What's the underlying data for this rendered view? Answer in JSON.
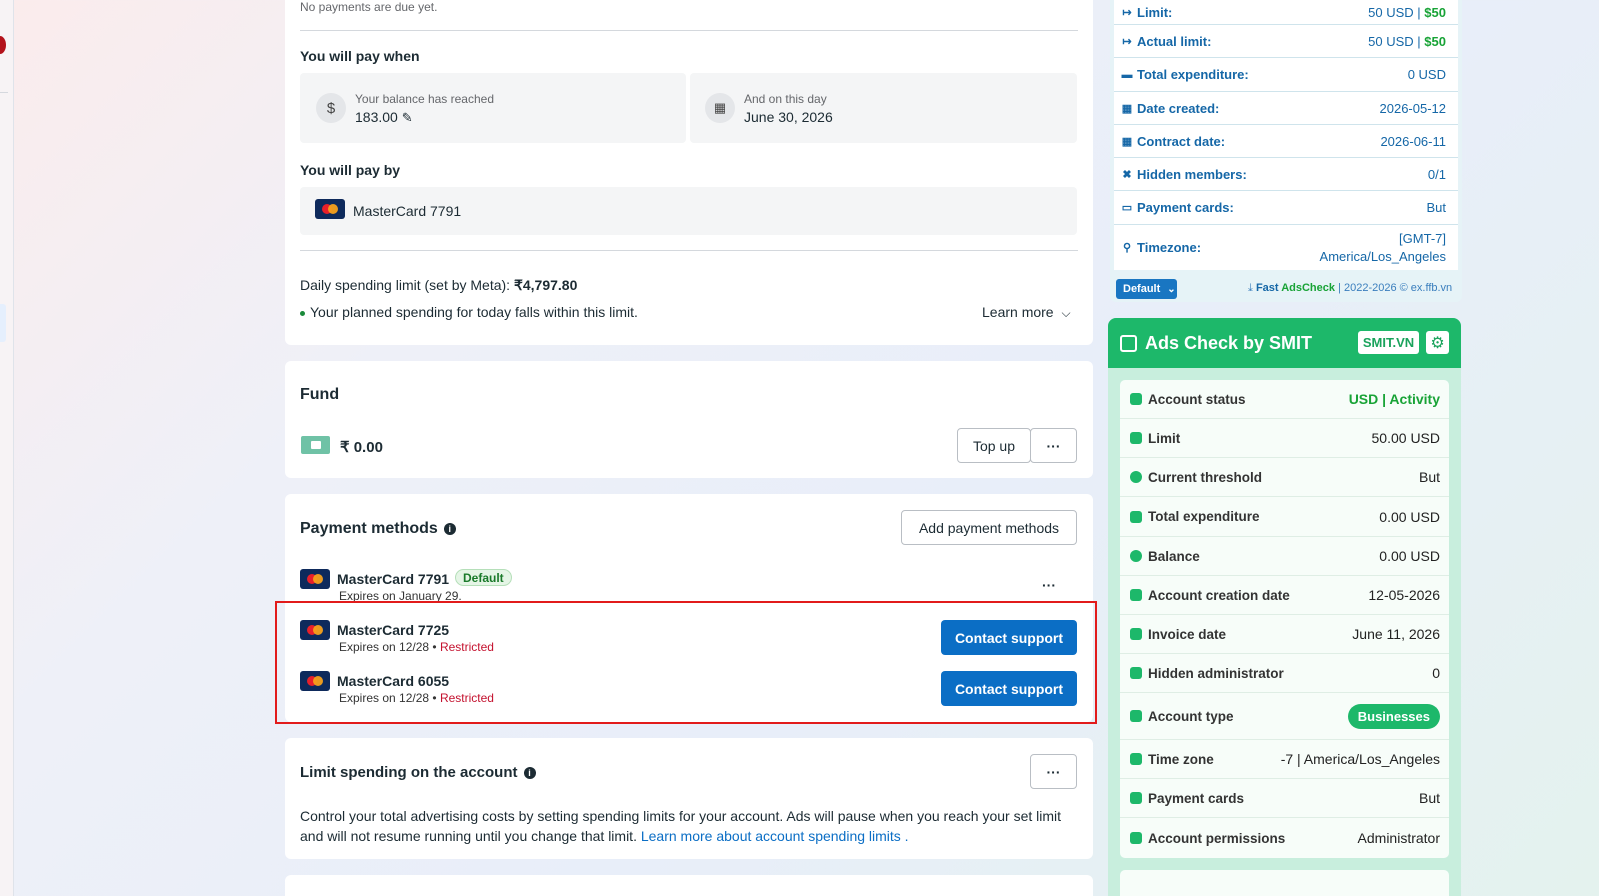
{
  "billing": {
    "no_payments": "No payments are due yet.",
    "pay_when_heading": "You will pay when",
    "balance_label": "Your balance has reached",
    "balance_value": "183.00",
    "day_label": "And on this day",
    "day_value": "June 30, 2026",
    "pay_by_heading": "You will pay by",
    "pay_by_card": "MasterCard 7791",
    "daily_limit_text": "Daily spending limit (set by Meta): ",
    "daily_limit_value": "₹4,797.80",
    "planned_text": "Your planned spending for today falls within this limit.",
    "learn_more": "Learn more"
  },
  "fund": {
    "title": "Fund",
    "amount": "₹ 0.00",
    "top_up": "Top up",
    "more": "···"
  },
  "payment_methods": {
    "title": "Payment methods",
    "add_button": "Add payment methods",
    "more": "···",
    "cards": [
      {
        "name": "MasterCard 7791",
        "badge": "Default",
        "expiry": "Expires on January 29."
      },
      {
        "name": "MasterCard 7725",
        "expiry": "Expires on 12/28 • ",
        "status": "Restricted",
        "action": "Contact support"
      },
      {
        "name": "MasterCard 6055",
        "expiry": "Expires on 12/28 • ",
        "status": "Restricted",
        "action": "Contact support"
      }
    ]
  },
  "limit_spending": {
    "title": "Limit spending on the account",
    "more": "···",
    "description": "Control your total advertising costs by setting spending limits for your account. Ads will pause when you reach your set limit and will not resume running until you change that limit. ",
    "link": "Learn more about account spending limits ."
  },
  "ext_panel": {
    "rows": [
      {
        "icon": "↦",
        "label": "Limit:",
        "value": "50 USD | ",
        "value_green": "$50"
      },
      {
        "icon": "↦",
        "label": "Actual limit:",
        "value": "50 USD | ",
        "value_green": "$50"
      },
      {
        "icon": "▬",
        "label": "Total expenditure:",
        "value": "0 USD"
      },
      {
        "icon": "▦",
        "label": "Date created:",
        "value": "2026-05-12"
      },
      {
        "icon": "▦",
        "label": "Contract date:",
        "value": "2026-06-11"
      },
      {
        "icon": "✖",
        "label": "Hidden members:",
        "value": "0/1"
      },
      {
        "icon": "▭",
        "label": "Payment cards:",
        "value": "But"
      },
      {
        "icon": "⚲",
        "label": "Timezone:",
        "value": "[GMT-7]",
        "value2": "America/Los_Angeles"
      }
    ],
    "default_button": "Default",
    "credit_brand": "Fast ",
    "credit_brand2": "AdsCheck",
    "credit_rest": " | 2022-2026 © ex.ffb.vn",
    "accent": "#1567a7"
  },
  "smit": {
    "title": "Ads Check by SMIT",
    "badge": "SMIT.VN",
    "accent": "#1db86a",
    "rows": [
      {
        "label": "Account status",
        "value": "USD | Activity",
        "style": "green"
      },
      {
        "label": "Limit",
        "value": "50.00 USD"
      },
      {
        "label": "Current threshold",
        "value": "But"
      },
      {
        "label": "Total expenditure",
        "value": "0.00 USD"
      },
      {
        "label": "Balance",
        "value": "0.00 USD"
      },
      {
        "label": "Account creation date",
        "value": "12-05-2026"
      },
      {
        "label": "Invoice date",
        "value": "June 11, 2026"
      },
      {
        "label": "Hidden administrator",
        "value": "0"
      },
      {
        "label": "Account type",
        "value": "Businesses",
        "style": "pill"
      },
      {
        "label": "Time zone",
        "value": "-7 | America/Los_Angeles"
      },
      {
        "label": "Payment cards",
        "value": "But"
      },
      {
        "label": "Account permissions",
        "value": "Administrator"
      }
    ]
  }
}
